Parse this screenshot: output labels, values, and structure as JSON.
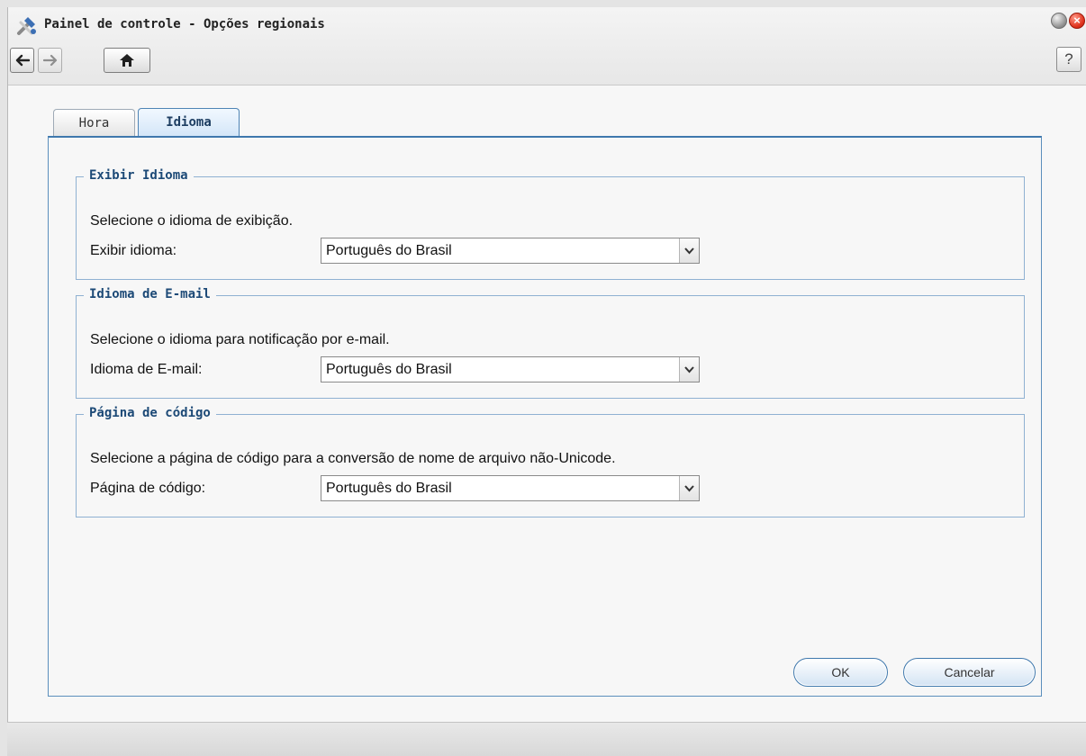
{
  "window": {
    "title": "Painel de controle - Opções regionais",
    "icon": "tools-icon",
    "help_label": "?"
  },
  "tabs": [
    {
      "label": "Hora",
      "active": false
    },
    {
      "label": "Idioma",
      "active": true
    }
  ],
  "sections": [
    {
      "legend": "Exibir Idioma",
      "description": "Selecione o idioma de exibição.",
      "field_label": "Exibir idioma:",
      "value": "Português do Brasil"
    },
    {
      "legend": "Idioma de E-mail",
      "description": "Selecione o idioma para notificação por e-mail.",
      "field_label": "Idioma de E-mail:",
      "value": "Português do Brasil"
    },
    {
      "legend": "Página de código",
      "description": "Selecione a página de código para a conversão de nome de arquivo não-Unicode.",
      "field_label": "Página de código:",
      "value": "Português do Brasil"
    }
  ],
  "buttons": {
    "ok": "OK",
    "cancel": "Cancelar"
  },
  "colors": {
    "accent": "#3f78ad",
    "legend_text": "#1d4a77",
    "close_button": "#e0321c"
  }
}
